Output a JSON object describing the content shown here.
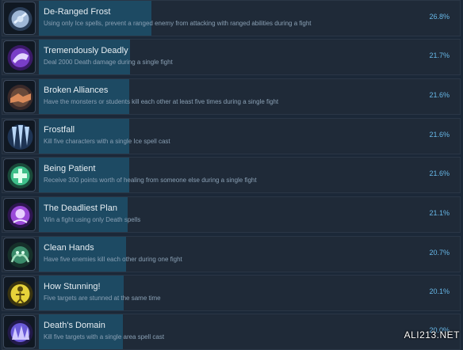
{
  "achievements": [
    {
      "title": "De-Ranged Frost",
      "description": "Using only Ice spells, prevent a ranged enemy from attacking with ranged abilities during a fight",
      "percent_label": "26.8%",
      "percent": 26.8,
      "icon": "frost-shield-icon",
      "icon_color": "#9fb7d6"
    },
    {
      "title": "Tremendously Deadly",
      "description": "Deal 2000 Death damage during a single fight",
      "percent_label": "21.7%",
      "percent": 21.7,
      "icon": "death-hand-icon",
      "icon_color": "#7a3ec8"
    },
    {
      "title": "Broken Alliances",
      "description": "Have the monsters or students kill each other at least five times during a single fight",
      "percent_label": "21.6%",
      "percent": 21.6,
      "icon": "handshake-icon",
      "icon_color": "#d98a5a"
    },
    {
      "title": "Frostfall",
      "description": "Kill five characters with a single Ice spell cast",
      "percent_label": "21.6%",
      "percent": 21.6,
      "icon": "icicles-icon",
      "icon_color": "#7fb0e6"
    },
    {
      "title": "Being Patient",
      "description": "Receive 300 points worth of healing from someone else during a single fight",
      "percent_label": "21.6%",
      "percent": 21.6,
      "icon": "healing-icon",
      "icon_color": "#3fbf8a"
    },
    {
      "title": "The Deadliest Plan",
      "description": "Win a fight using only Death spells",
      "percent_label": "21.1%",
      "percent": 21.1,
      "icon": "death-orb-icon",
      "icon_color": "#9a4ad8"
    },
    {
      "title": "Clean Hands",
      "description": "Have five enemies kill each other during one fight",
      "percent_label": "20.7%",
      "percent": 20.7,
      "icon": "tentacle-icon",
      "icon_color": "#3a8a6a"
    },
    {
      "title": "How Stunning!",
      "description": "Five targets are stunned at the same time",
      "percent_label": "20.1%",
      "percent": 20.1,
      "icon": "stun-figure-icon",
      "icon_color": "#e6d23a"
    },
    {
      "title": "Death's Domain",
      "description": "Kill five targets with a single area spell cast",
      "percent_label": "20.0%",
      "percent": 20.0,
      "icon": "death-domain-icon",
      "icon_color": "#6a5ad8"
    }
  ],
  "watermark": "ALI213.NET"
}
